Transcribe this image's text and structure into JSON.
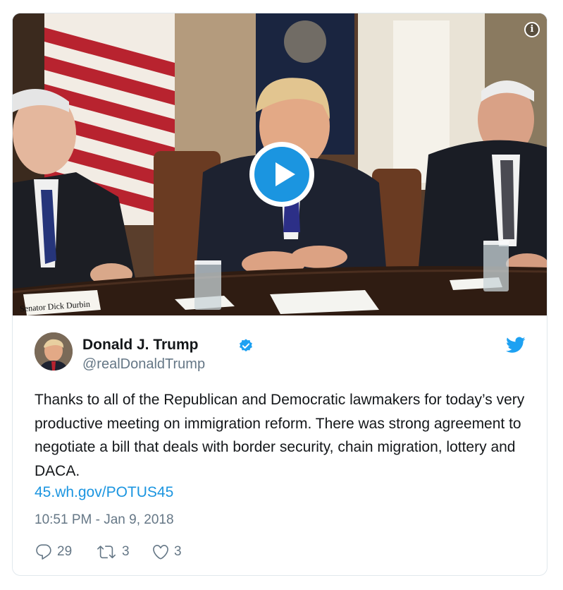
{
  "media": {
    "nameplate": "Senator Dick Durbin",
    "info_icon": "info-icon",
    "play_icon": "play-icon",
    "accent": "#1b95e0"
  },
  "tweet": {
    "author_name": "Donald J. Trump",
    "handle": "@realDonaldTrump",
    "verified_icon": "verified-badge-icon",
    "brand_icon": "twitter-bird-icon",
    "text": "Thanks to all of the Republican and Democratic lawmakers for today’s very productive meeting on immigration reform. There was strong agreement to negotiate a bill that deals with border security, chain migration, lottery and DACA.",
    "link": "45.wh.gov/POTUS45",
    "timestamp": "10:51 PM - Jan 9, 2018"
  },
  "actions": {
    "replies": "29",
    "retweets": "3",
    "likes": "3"
  },
  "colors": {
    "text": "#14171a",
    "secondary": "#657786",
    "link": "#1b95e0",
    "border": "#e1e8ed"
  }
}
